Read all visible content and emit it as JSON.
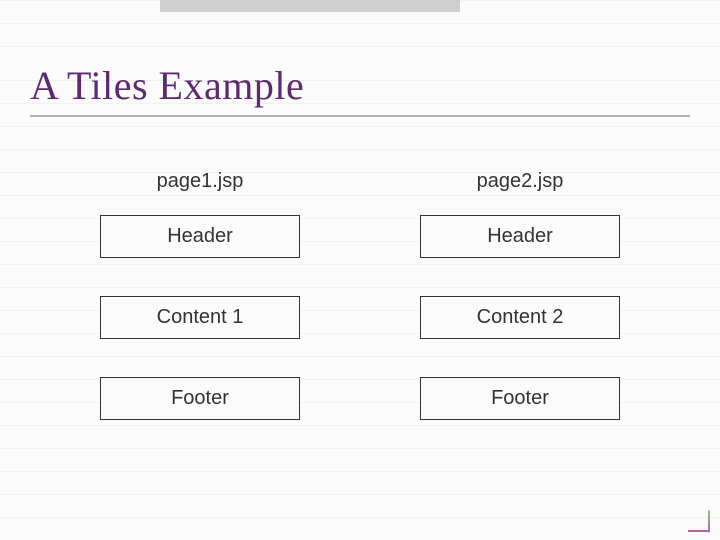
{
  "title": "A Tiles Example",
  "pages": {
    "left": {
      "label": "page1.jsp",
      "header": "Header",
      "content": "Content 1",
      "footer": "Footer"
    },
    "right": {
      "label": "page2.jsp",
      "header": "Header",
      "content": "Content 2",
      "footer": "Footer"
    }
  }
}
